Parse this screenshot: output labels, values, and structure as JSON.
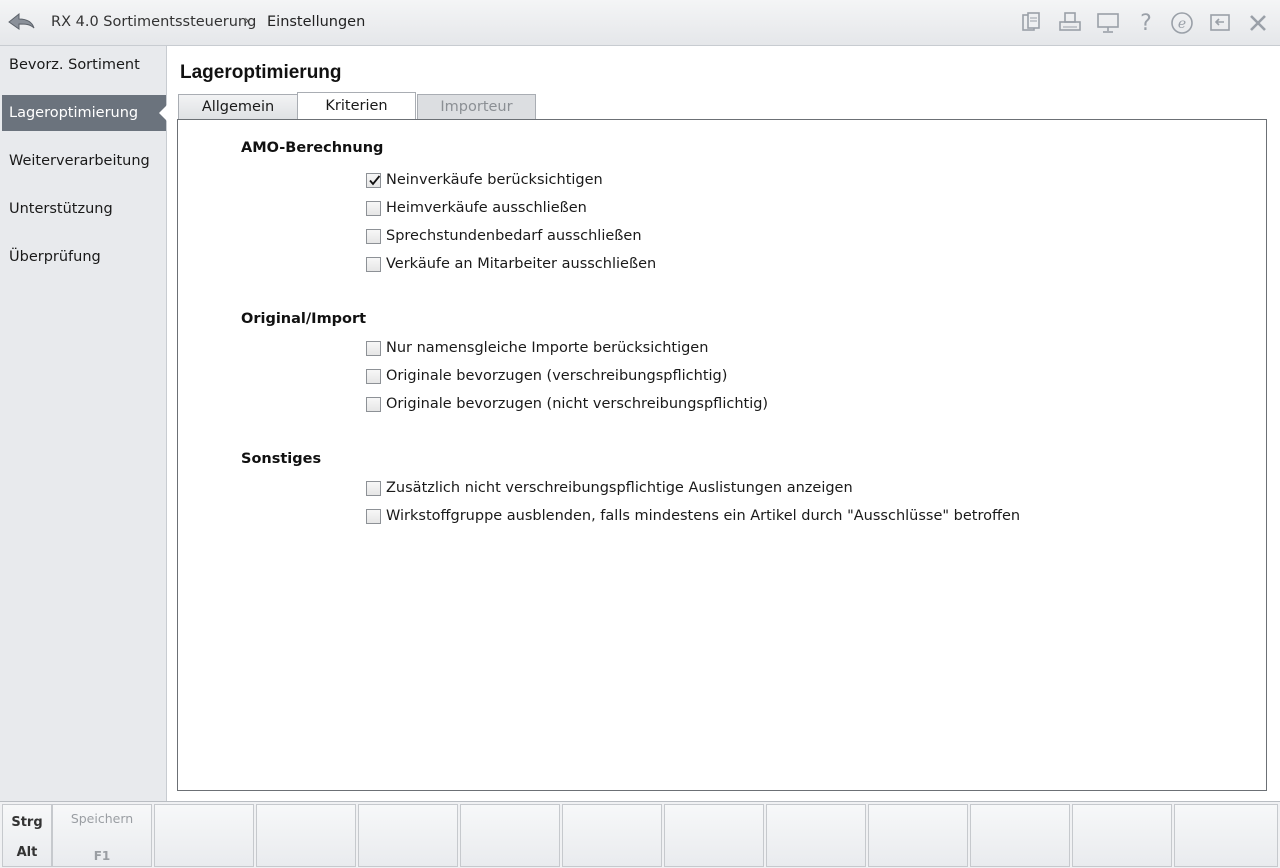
{
  "header": {
    "breadcrumb": [
      "RX 4.0 Sortimentssteuerung",
      "Einstellungen"
    ],
    "icons": [
      "documents-icon",
      "printer-icon",
      "monitor-icon",
      "help-icon",
      "e-icon",
      "exit-window-icon",
      "close-icon"
    ]
  },
  "sidebar": {
    "items": [
      {
        "label": "Bevorz. Sortiment",
        "active": false
      },
      {
        "label": "Lageroptimierung",
        "active": true
      },
      {
        "label": "Weiterverarbeitung",
        "active": false
      },
      {
        "label": "Unterstützung",
        "active": false
      },
      {
        "label": "Überprüfung",
        "active": false
      }
    ]
  },
  "main": {
    "title": "Lageroptimierung",
    "tabs": [
      {
        "label": "Allgemein",
        "state": "inactive"
      },
      {
        "label": "Kriterien",
        "state": "active"
      },
      {
        "label": "Importeur",
        "state": "disabled"
      }
    ],
    "sections": [
      {
        "title": "AMO-Berechnung",
        "options": [
          {
            "label": "Neinverkäufe berücksichtigen",
            "checked": true
          },
          {
            "label": "Heimverkäufe ausschließen",
            "checked": false
          },
          {
            "label": "Sprechstundenbedarf ausschließen",
            "checked": false
          },
          {
            "label": "Verkäufe an Mitarbeiter ausschließen",
            "checked": false
          }
        ]
      },
      {
        "title": "Original/Import",
        "options": [
          {
            "label": "Nur namensgleiche Importe berücksichtigen",
            "checked": false
          },
          {
            "label": "Originale bevorzugen (verschreibungspflichtig)",
            "checked": false
          },
          {
            "label": "Originale bevorzugen (nicht verschreibungspflichtig)",
            "checked": false
          }
        ]
      },
      {
        "title": "Sonstiges",
        "options": [
          {
            "label": "Zusätzlich nicht verschreibungspflichtige Auslistungen anzeigen",
            "checked": false
          },
          {
            "label": "Wirkstoffgruppe ausblenden, falls mindestens ein Artikel durch \"Ausschlüsse\" betroffen",
            "checked": false
          }
        ]
      }
    ]
  },
  "footer": {
    "modifiers": [
      "Strg",
      "Alt"
    ],
    "keys": [
      {
        "label": "Speichern",
        "code": "F1",
        "enabled": false
      }
    ]
  }
}
